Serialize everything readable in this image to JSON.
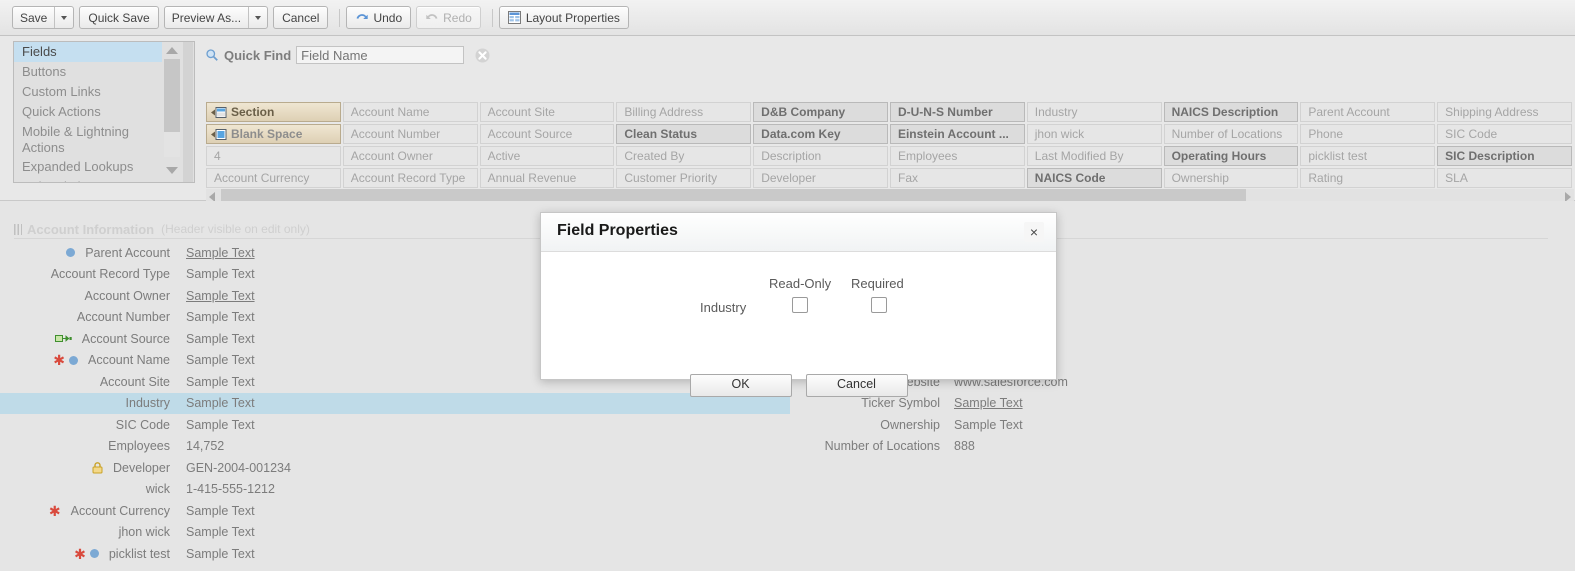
{
  "toolbar": {
    "save": "Save",
    "quick_save": "Quick Save",
    "preview_as": "Preview As...",
    "cancel": "Cancel",
    "undo": "Undo",
    "redo": "Redo",
    "layout_properties": "Layout Properties"
  },
  "sidebar": {
    "items": [
      {
        "label": "Fields",
        "selected": true
      },
      {
        "label": "Buttons",
        "selected": false
      },
      {
        "label": "Custom Links",
        "selected": false
      },
      {
        "label": "Quick Actions",
        "selected": false
      },
      {
        "label": "Mobile & Lightning Actions",
        "selected": false
      },
      {
        "label": "Expanded Lookups",
        "selected": false
      },
      {
        "label": "Related Lists",
        "selected": false
      }
    ]
  },
  "quick_find": {
    "label": "Quick Find",
    "placeholder": "Field Name",
    "value": ""
  },
  "palette": {
    "rows": [
      [
        "Section",
        "Account Name",
        "Account Site",
        "Billing Address",
        "D&B Company",
        "D-U-N-S Number",
        "Industry",
        "NAICS Description",
        "Parent Account",
        "Shipping Address"
      ],
      [
        "Blank Space",
        "Account Number",
        "Account Source",
        "Clean Status",
        "Data.com Key",
        "Einstein Account ...",
        "jhon wick",
        "Number of Locations",
        "Phone",
        "SIC Code"
      ],
      [
        "4",
        "Account Owner",
        "Active",
        "Created By",
        "Description",
        "Employees",
        "Last Modified By",
        "Operating Hours",
        "picklist test",
        "SIC Description"
      ],
      [
        "Account Currency",
        "Account Record Type",
        "Annual Revenue",
        "Customer Priority",
        "Developer",
        "Fax",
        "NAICS Code",
        "Ownership",
        "Rating",
        "SLA"
      ]
    ]
  },
  "section": {
    "title": "Account Information",
    "note": "(Header visible on edit only)"
  },
  "layout": {
    "left_column": [
      {
        "label": "Parent Account",
        "value": "Sample Text",
        "link": true,
        "lookup": true,
        "required": false
      },
      {
        "label": "Account Record Type",
        "value": "Sample Text",
        "link": false,
        "lookup": false,
        "required": false
      },
      {
        "label": "Account Owner",
        "value": "Sample Text",
        "link": true,
        "lookup": false,
        "required": false
      },
      {
        "label": "Account Number",
        "value": "Sample Text",
        "link": false,
        "lookup": false,
        "required": false
      },
      {
        "label": "Account Source",
        "value": "Sample Text",
        "link": false,
        "lookup": false,
        "required": false,
        "source_icon": true
      },
      {
        "label": "Account Name",
        "value": "Sample Text",
        "link": false,
        "lookup": true,
        "required": true
      },
      {
        "label": "Account Site",
        "value": "Sample Text",
        "link": false,
        "lookup": false,
        "required": false
      },
      {
        "label": "Industry",
        "value": "Sample Text",
        "link": false,
        "lookup": false,
        "required": false,
        "highlighted": true
      },
      {
        "label": "SIC Code",
        "value": "Sample Text",
        "link": false,
        "lookup": false,
        "required": false
      },
      {
        "label": "Employees",
        "value": "14,752",
        "link": false,
        "lookup": false,
        "required": false
      },
      {
        "label": "Developer",
        "value": "GEN-2004-001234",
        "link": false,
        "lookup": false,
        "required": false,
        "lock_icon": true
      },
      {
        "label": "wick",
        "value": "1-415-555-1212",
        "link": false,
        "lookup": false,
        "required": false
      },
      {
        "label": "Account Currency",
        "value": "Sample Text",
        "link": false,
        "lookup": false,
        "required": true
      },
      {
        "label": "jhon wick",
        "value": "Sample Text",
        "link": false,
        "lookup": false,
        "required": false
      },
      {
        "label": "picklist test",
        "value": "Sample Text",
        "link": false,
        "lookup": true,
        "required": true
      }
    ],
    "right_column": [
      {
        "label": "Website",
        "value": "www.salesforce.com",
        "link": false
      },
      {
        "label": "Ticker Symbol",
        "value": "Sample Text",
        "link": true
      },
      {
        "label": "Ownership",
        "value": "Sample Text",
        "link": false
      },
      {
        "label": "Number of Locations",
        "value": "888",
        "link": false
      }
    ]
  },
  "modal": {
    "title": "Field Properties",
    "field_name": "Industry",
    "read_only_label": "Read-Only",
    "required_label": "Required",
    "read_only_checked": false,
    "required_checked": false,
    "ok": "OK",
    "cancel": "Cancel",
    "close": "×"
  },
  "colors": {
    "highlight_row": "#bfdbe8",
    "sidebar_selected": "#c5dff0",
    "required_star": "#d94a3d",
    "lookup_dot": "#7ca9d4",
    "palette_special": "#ded0b4"
  }
}
